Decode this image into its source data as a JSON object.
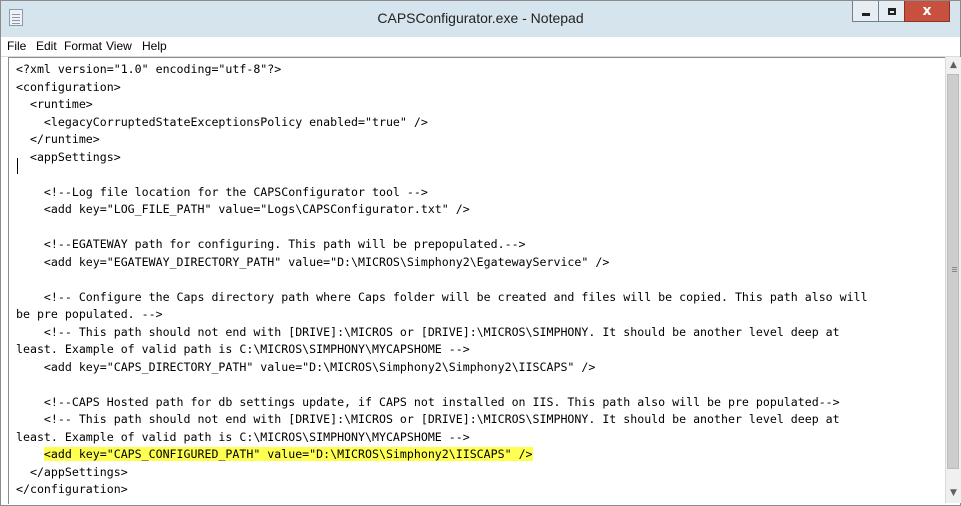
{
  "window": {
    "title": "CAPSConfigurator.exe - Notepad"
  },
  "title_controls": {
    "minimize": "minimize",
    "maximize": "maximize",
    "close": "x"
  },
  "menu": [
    "File",
    "Edit",
    "Format",
    "View",
    "Help"
  ],
  "document": {
    "highlight_color": "#ffff52",
    "lines": [
      "<?xml version=\"1.0\" encoding=\"utf-8\"?>",
      "<configuration>",
      "  <runtime>",
      "    <legacyCorruptedStateExceptionsPolicy enabled=\"true\" />",
      "  </runtime>",
      "  <appSettings>",
      "",
      "    <!--Log file location for the CAPSConfigurator tool -->",
      "    <add key=\"LOG_FILE_PATH\" value=\"Logs\\CAPSConfigurator.txt\" />",
      "",
      "    <!--EGATEWAY path for configuring. This path will be prepopulated.-->",
      "    <add key=\"EGATEWAY_DIRECTORY_PATH\" value=\"D:\\MICROS\\Simphony2\\EgatewayService\" />",
      "",
      "    <!-- Configure the Caps directory path where Caps folder will be created and files will be copied. This path also will",
      "be pre populated. -->",
      "    <!-- This path should not end with [DRIVE]:\\MICROS or [DRIVE]:\\MICROS\\SIMPHONY. It should be another level deep at",
      "least. Example of valid path is C:\\MICROS\\SIMPHONY\\MYCAPSHOME -->",
      "    <add key=\"CAPS_DIRECTORY_PATH\" value=\"D:\\MICROS\\Simphony2\\Simphony2\\IISCAPS\" />",
      "",
      "    <!--CAPS Hosted path for db settings update, if CAPS not installed on IIS. This path also will be pre populated-->",
      "    <!-- This path should not end with [DRIVE]:\\MICROS or [DRIVE]:\\MICROS\\SIMPHONY. It should be another level deep at",
      "least. Example of valid path is C:\\MICROS\\SIMPHONY\\MYCAPSHOME -->",
      "    ",
      "  </appSettings>",
      "</configuration>"
    ],
    "highlighted_text": "<add key=\"CAPS_CONFIGURED_PATH\" value=\"D:\\MICROS\\Simphony2\\IISCAPS\" />"
  }
}
